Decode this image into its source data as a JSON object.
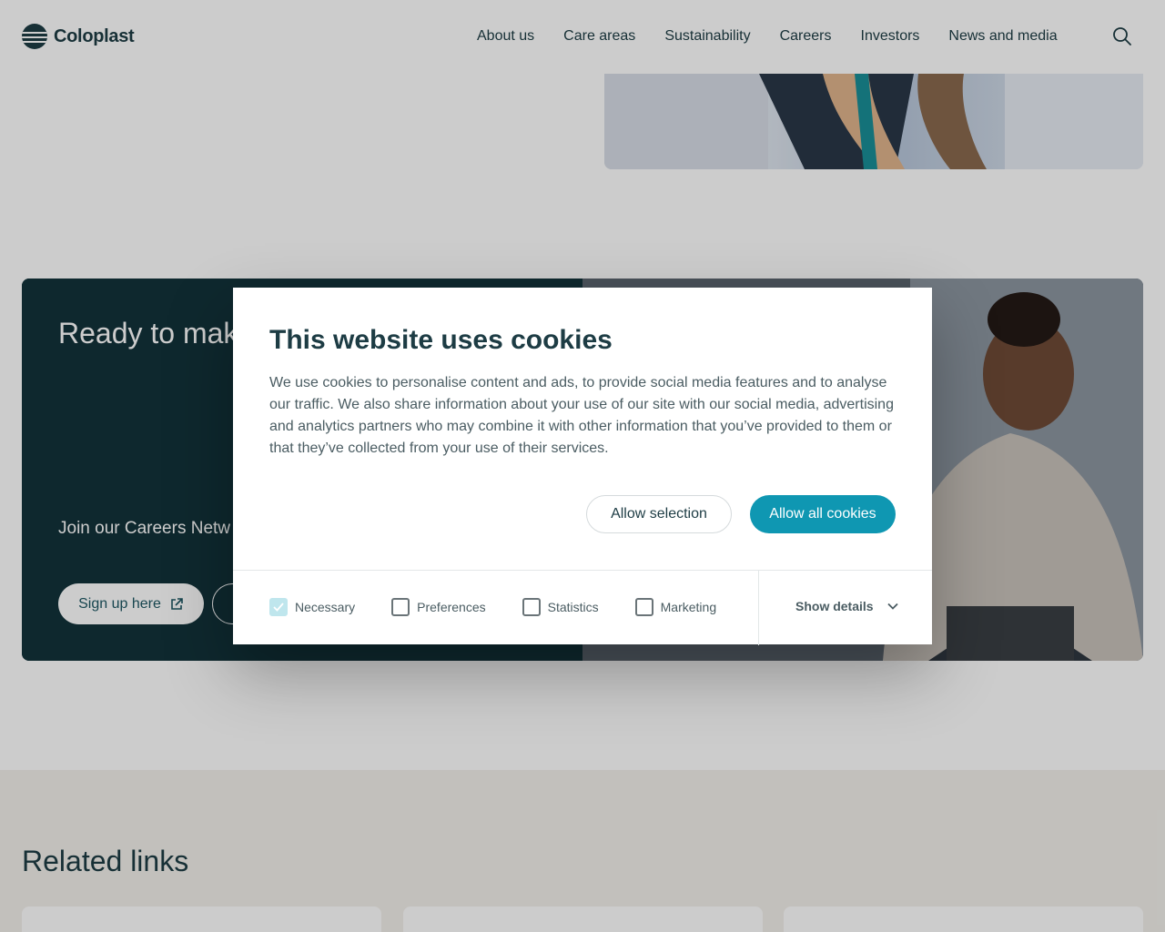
{
  "header": {
    "logo_text": "Coloplast",
    "nav": [
      "About us",
      "Care areas",
      "Sustainability",
      "Careers",
      "Investors",
      "News and media"
    ]
  },
  "cta": {
    "title": "Ready to mak",
    "text": "Join our Careers Netw opportunities.",
    "signup_label": "Sign up here"
  },
  "related": {
    "title": "Related links"
  },
  "cookie": {
    "title": "This website uses cookies",
    "body": "We use cookies to personalise content and ads, to provide social media features and to analyse our traffic. We also share information about your use of our site with our social media, advertising and analytics partners who may combine it with other information that you’ve provided to them or that they’ve collected from your use of their services.",
    "allow_selection": "Allow selection",
    "allow_all": "Allow all cookies",
    "options": [
      {
        "label": "Necessary",
        "checked": true
      },
      {
        "label": "Preferences",
        "checked": false
      },
      {
        "label": "Statistics",
        "checked": false
      },
      {
        "label": "Marketing",
        "checked": false
      }
    ],
    "show_details": "Show details"
  },
  "colors": {
    "accent": "#0f97b2",
    "dark": "#12323a"
  }
}
